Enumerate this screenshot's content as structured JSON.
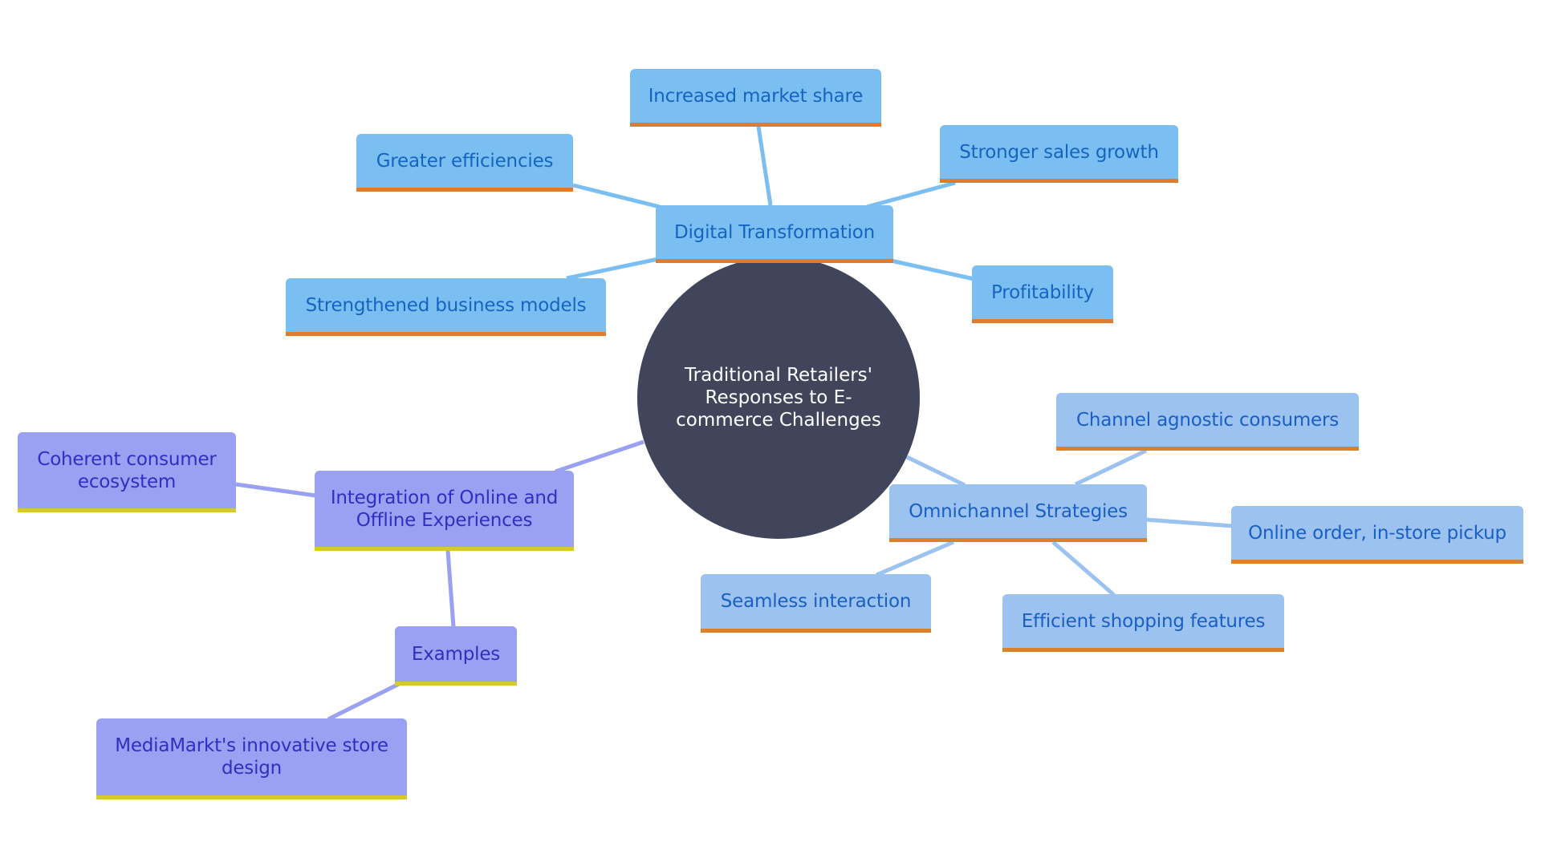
{
  "diagram": {
    "type": "mindmap",
    "root": {
      "id": "root",
      "label": "Traditional Retailers' Responses to E-commerce Challenges",
      "color": "#41455c"
    },
    "groups": {
      "digital": {
        "fill": "#7bbff2",
        "text": "#1565c0",
        "accent": "#e07b2e",
        "edge": "#7bbff2"
      },
      "omni": {
        "fill": "#9cc2ef",
        "text": "#1a5fc4",
        "accent": "#d9822b",
        "edge": "#9cc2ef"
      },
      "integration": {
        "fill": "#9aa0f2",
        "text": "#2f2fc0",
        "accent": "#d8c92a",
        "edge": "#9aa0f2"
      }
    },
    "nodes": [
      {
        "id": "digital",
        "label": "Digital Transformation",
        "parent": "root",
        "group": "digital"
      },
      {
        "id": "market",
        "label": "Increased market share",
        "parent": "digital",
        "group": "digital"
      },
      {
        "id": "efficiencies",
        "label": "Greater efficiencies",
        "parent": "digital",
        "group": "digital"
      },
      {
        "id": "sales",
        "label": "Stronger sales growth",
        "parent": "digital",
        "group": "digital"
      },
      {
        "id": "business",
        "label": "Strengthened business models",
        "parent": "digital",
        "group": "digital"
      },
      {
        "id": "profit",
        "label": "Profitability",
        "parent": "digital",
        "group": "digital"
      },
      {
        "id": "omni",
        "label": "Omnichannel Strategies",
        "parent": "root",
        "group": "omni"
      },
      {
        "id": "agnostic",
        "label": "Channel agnostic consumers",
        "parent": "omni",
        "group": "omni"
      },
      {
        "id": "pickup",
        "label": "Online order, in-store pickup",
        "parent": "omni",
        "group": "omni"
      },
      {
        "id": "seamless",
        "label": "Seamless interaction",
        "parent": "omni",
        "group": "omni"
      },
      {
        "id": "efficient",
        "label": "Efficient shopping features",
        "parent": "omni",
        "group": "omni"
      },
      {
        "id": "integration",
        "label": "Integration of Online and Offline Experiences",
        "parent": "root",
        "group": "integration"
      },
      {
        "id": "coherent",
        "label": "Coherent consumer ecosystem",
        "parent": "integration",
        "group": "integration"
      },
      {
        "id": "examples",
        "label": "Examples",
        "parent": "integration",
        "group": "integration"
      },
      {
        "id": "mediamarkt",
        "label": "MediaMarkt's innovative store design",
        "parent": "examples",
        "group": "integration"
      }
    ]
  }
}
